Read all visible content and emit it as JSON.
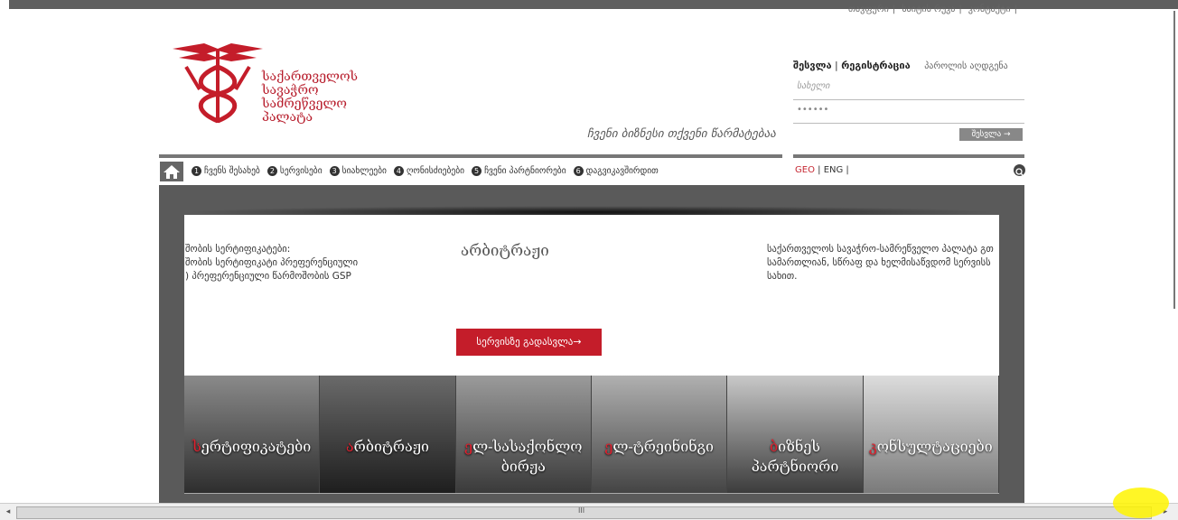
{
  "top_links": [
    "თავფური",
    "საიტის რუკა",
    "კონტაქტი"
  ],
  "logo": {
    "lines": [
      "საქართველოს",
      "სავაჭრო",
      "სამრეწველო",
      "პალატა"
    ],
    "brand_color": "#b71c2b"
  },
  "slogan": "ჩვენი ბიზნესი თქვენი წარმატებაა",
  "login": {
    "enter": "შესვლა",
    "register": "რეგისტრაცია",
    "recover": "პაროლის აღდგენა",
    "username_placeholder": "სახელი",
    "password_value": "••••••",
    "submit": "შესვლა →"
  },
  "nav": {
    "home_icon": "home-icon",
    "items": [
      {
        "num": "1",
        "label": "ჩვენს შესახებ"
      },
      {
        "num": "2",
        "label": "სერვისები"
      },
      {
        "num": "3",
        "label": "სიახლეები"
      },
      {
        "num": "4",
        "label": "ღონისძიებები"
      },
      {
        "num": "5",
        "label": "ჩვენი პარტნიორები"
      },
      {
        "num": "6",
        "label": "დაგვიკავშირდით"
      }
    ],
    "lang_geo": "GEO",
    "lang_eng": "ENG",
    "search_icon": "search-icon"
  },
  "slide": {
    "left_lines": [
      "შობის სერტიფიკატები:",
      "შობის სერტიფიკატი პრეფერენციული",
      ") პრეფერენციული წარმოშობის GSP"
    ],
    "title": "არბიტრაჟი",
    "right_text": "საქართველოს სავაჭრო-სამრეწველო პალატა გთ სამართლიან, სწრაფ და ხელმისაწვდომ სერვისს სახით.",
    "button": "სერვისზე გადასვლა→"
  },
  "tiles": [
    {
      "first": "ს",
      "rest": "ერტიფიკატები",
      "line2": ""
    },
    {
      "first": "ა",
      "rest": "რბიტრაჟი",
      "line2": ""
    },
    {
      "first": "ე",
      "rest": "ლ-სასაქონლო",
      "line2": "ბირჟა"
    },
    {
      "first": "ე",
      "rest": "ლ-ტრეინინგი",
      "line2": ""
    },
    {
      "first": "ბ",
      "rest": "იზნეს",
      "line2": "პარტნიორი"
    },
    {
      "first": "კ",
      "rest": "ონსულტაციები",
      "line2": ""
    }
  ],
  "scrollbar": {
    "grip": "III"
  }
}
